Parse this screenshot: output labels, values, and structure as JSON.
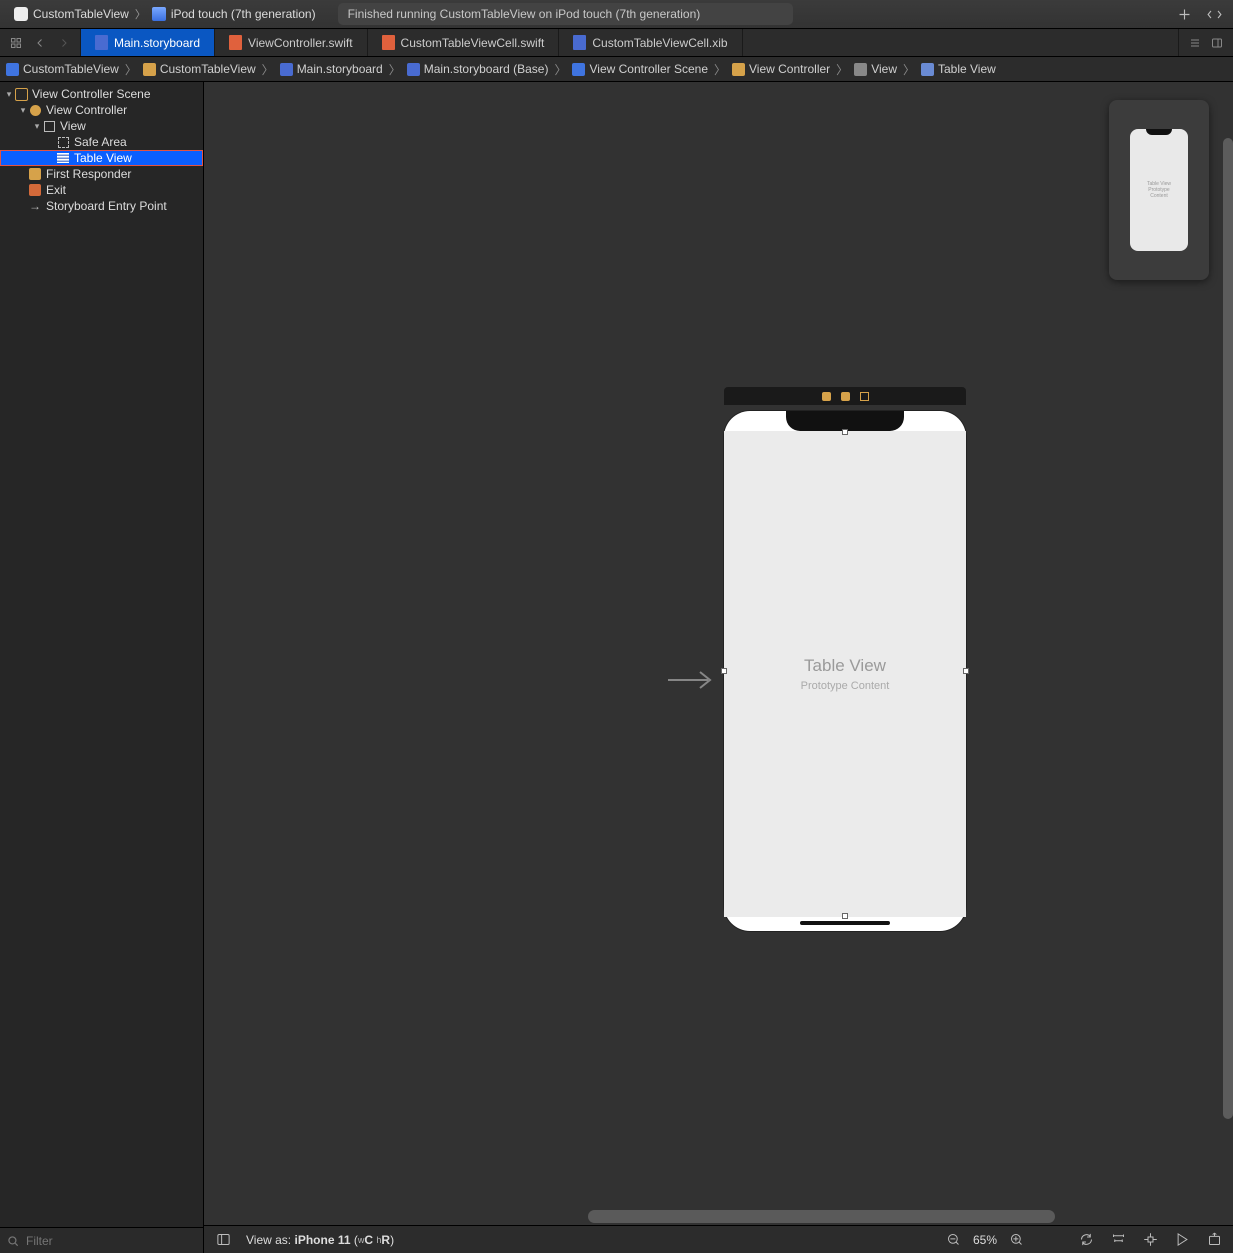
{
  "toolbar": {
    "scheme": "CustomTableView",
    "destination": "iPod touch (7th generation)",
    "status": "Finished running CustomTableView on iPod touch (7th generation)"
  },
  "tabs": [
    {
      "label": "Main.storyboard",
      "kind": "storyboard",
      "active": true
    },
    {
      "label": "ViewController.swift",
      "kind": "swift",
      "active": false
    },
    {
      "label": "CustomTableViewCell.swift",
      "kind": "swift",
      "active": false
    },
    {
      "label": "CustomTableViewCell.xib",
      "kind": "xib",
      "active": false
    }
  ],
  "path": [
    {
      "label": "CustomTableView",
      "icon": "proj"
    },
    {
      "label": "CustomTableView",
      "icon": "folder"
    },
    {
      "label": "Main.storyboard",
      "icon": "sb"
    },
    {
      "label": "Main.storyboard (Base)",
      "icon": "sb"
    },
    {
      "label": "View Controller Scene",
      "icon": "scene"
    },
    {
      "label": "View Controller",
      "icon": "vc"
    },
    {
      "label": "View",
      "icon": "view"
    },
    {
      "label": "Table View",
      "icon": "tview"
    }
  ],
  "outline": {
    "filter_placeholder": "Filter",
    "nodes": [
      {
        "label": "View Controller Scene",
        "icon": "scene",
        "indent": 0,
        "disclosure": "open"
      },
      {
        "label": "View Controller",
        "icon": "vc",
        "indent": 1,
        "disclosure": "open"
      },
      {
        "label": "View",
        "icon": "view",
        "indent": 2,
        "disclosure": "open"
      },
      {
        "label": "Safe Area",
        "icon": "safe",
        "indent": 3,
        "disclosure": "none"
      },
      {
        "label": "Table View",
        "icon": "tview",
        "indent": 3,
        "disclosure": "none",
        "selected": true,
        "highlighted": true
      },
      {
        "label": "First Responder",
        "icon": "fr",
        "indent": 1,
        "disclosure": "none"
      },
      {
        "label": "Exit",
        "icon": "exit",
        "indent": 1,
        "disclosure": "none"
      },
      {
        "label": "Storyboard Entry Point",
        "icon": "arrow",
        "indent": 1,
        "disclosure": "none"
      }
    ]
  },
  "canvas": {
    "table_view_title": "Table View",
    "table_view_subtitle": "Prototype Content",
    "minimap_title": "Table View",
    "minimap_subtitle": "Prototype Content"
  },
  "canvas_bar": {
    "view_as_prefix": "View as:",
    "device": "iPhone 11",
    "size_class_w": "C",
    "size_class_h": "R",
    "zoom": "65%"
  }
}
